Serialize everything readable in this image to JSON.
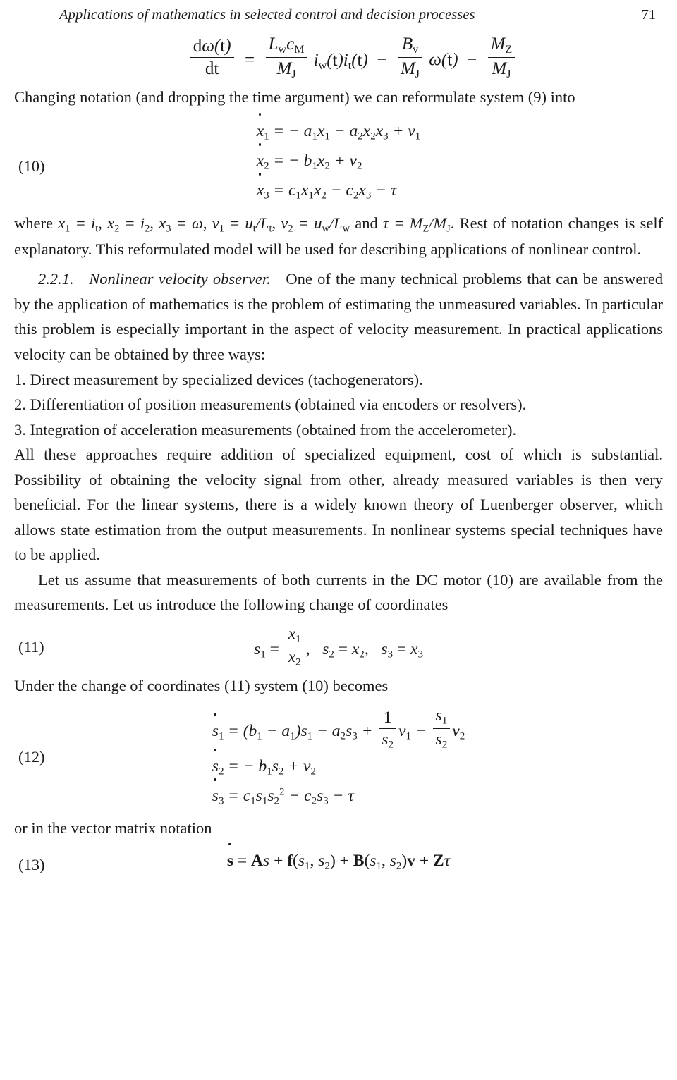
{
  "running_head": {
    "title": "Applications of mathematics in selected control and decision processes",
    "page_number": "71"
  },
  "equations": {
    "motor_eq": {
      "lhs_num": "dω(t)",
      "lhs_den": "dt",
      "rel": "=",
      "term1_num": "L",
      "term1_num_sub": "w",
      "term1_num_c": "c",
      "term1_num_csub": "M",
      "term1_den": "M",
      "term1_den_sub": "J",
      "term1_tail": "i",
      "term1_tail_sub": "w",
      "term1_tail2": "(t)i",
      "term1_tail2_sub": "t",
      "term1_tail3": "(t)",
      "minus1": "−",
      "term2_num": "B",
      "term2_num_sub": "v",
      "term2_den": "M",
      "term2_den_sub": "J",
      "term2_tail": "ω(t)",
      "minus2": "−",
      "term3_num": "M",
      "term3_num_sub": "Z",
      "term3_den": "M",
      "term3_den_sub": "J"
    },
    "eq10": {
      "tag": "(10)",
      "rows": [
        {
          "lhs_dot": "x",
          "lhs_sub": "1",
          "rel": "=",
          "rhs": "− a₁x₁ − a₂x₂x₃ + v₁"
        },
        {
          "lhs_dot": "x",
          "lhs_sub": "2",
          "rel": "=",
          "rhs": "− b₁x₂ + v₂"
        },
        {
          "lhs_dot": "x",
          "lhs_sub": "3",
          "rel": "=",
          "rhs": "c₁x₁x₂ − c₂x₃ − τ"
        }
      ]
    },
    "eq11": {
      "tag": "(11)",
      "text_lead": "s",
      "text": "s₁ = x₁/x₂,  s₂ = x₂,  s₃ = x₃"
    },
    "eq12": {
      "tag": "(12)",
      "rows": [
        {
          "lhs_dot": "s",
          "lhs_sub": "1",
          "rel": "=",
          "rhs": "(b₁ − a₁)s₁ − a₂s₃ + (1/s₂)v₁ − (s₁/s₂)v₂"
        },
        {
          "lhs_dot": "s",
          "lhs_sub": "2",
          "rel": "=",
          "rhs": "− b₁s₂ + v₂"
        },
        {
          "lhs_dot": "s",
          "lhs_sub": "3",
          "rel": "=",
          "rhs": "c₁s₁s₂² − c₂s₃ − τ"
        }
      ]
    },
    "eq13": {
      "tag": "(13)",
      "body": "ṡ = As + f(s₁, s₂) + B(s₁, s₂)v + Zτ"
    }
  },
  "paragraphs": {
    "reformulate": "Changing notation (and dropping the time argument) we can reformulate system (9) into",
    "where_line": "where x₁ = iₜ, x₂ = i₂, x₃ = ω, v₁ = uₜ/Lₜ, v₂ = u_w/L_w and τ = M_Z/M_J. Rest of notation changes is self explanatory. This reformulated model will be used for describing applications of nonlinear control.",
    "section_number": "2.2.1.",
    "section_title": "Nonlinear velocity observer.",
    "section_body": "One of the many technical problems that can be answered by the application of mathematics is the problem of estimating the unmeasured variables. In particular this problem is especially important in the aspect of velocity measurement. In practical applications velocity can be obtained by three ways:",
    "list": [
      "1. Direct measurement by specialized devices (tachogenerators).",
      "2. Differentiation of position measurements (obtained via encoders or resolvers).",
      "3. Integration of acceleration measurements (obtained from the accelerometer)."
    ],
    "approaches": "All these approaches require addition of specialized equipment, cost of which is substantial. Possibility of obtaining the velocity signal from other, already measured variables is then very beneficial. For the linear systems, there is a widely known theory of Luenberger observer, which allows state estimation from the output measurements. In nonlinear systems special techniques have to be applied.",
    "assume": "Let us assume that measurements of both currents in the DC motor (10) are available from the measurements. Let us introduce the following change of coordinates",
    "under_change": "Under the change of coordinates (11) system (10) becomes",
    "vector_matrix": "or in the vector matrix notation"
  }
}
